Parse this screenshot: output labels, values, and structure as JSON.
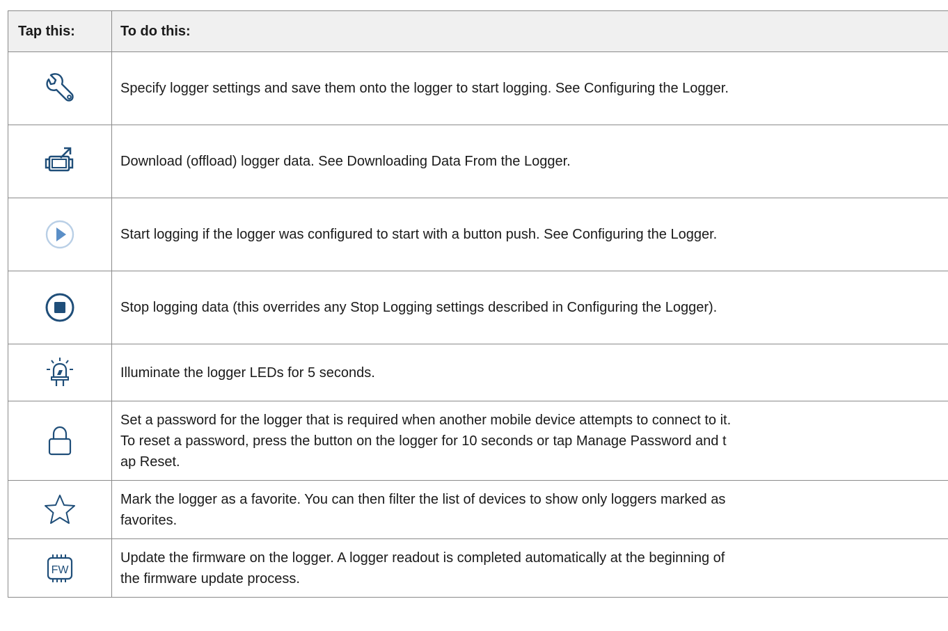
{
  "table": {
    "headers": {
      "col1": "Tap this:",
      "col2": "To do this:"
    },
    "rows": [
      {
        "icon": "wrench-icon",
        "text": "Specify logger settings and save them onto the logger to start logging. See Configuring the Logger."
      },
      {
        "icon": "download-offload-icon",
        "text": "Download (offload) logger data. See Downloading Data From the Logger."
      },
      {
        "icon": "play-icon",
        "text": "Start logging if the logger was configured to start with a button push. See Configuring the Logger."
      },
      {
        "icon": "stop-icon",
        "text": "Stop logging data (this overrides any Stop Logging settings described in Configuring the Logger)."
      },
      {
        "icon": "led-icon",
        "text": "Illuminate the logger LEDs for 5 seconds."
      },
      {
        "icon": "lock-icon",
        "text": "Set a password for the logger that is required when another mobile device attempts to connect to it.\nTo reset a password, press the button on the logger for 10 seconds or tap Manage Password and t\nap Reset."
      },
      {
        "icon": "star-icon",
        "text": "Mark the logger as a favorite. You can then filter the list of devices to show only loggers marked as\nfavorites."
      },
      {
        "icon": "firmware-icon",
        "text": "Update the firmware on the logger. A logger readout is completed automatically at the beginning of\nthe firmware update process."
      }
    ]
  },
  "colors": {
    "icon_blue": "#1f4e79",
    "icon_light_blue": "#5b8fc7",
    "border": "#8a8a8a",
    "header_bg": "#f0f0f0"
  }
}
